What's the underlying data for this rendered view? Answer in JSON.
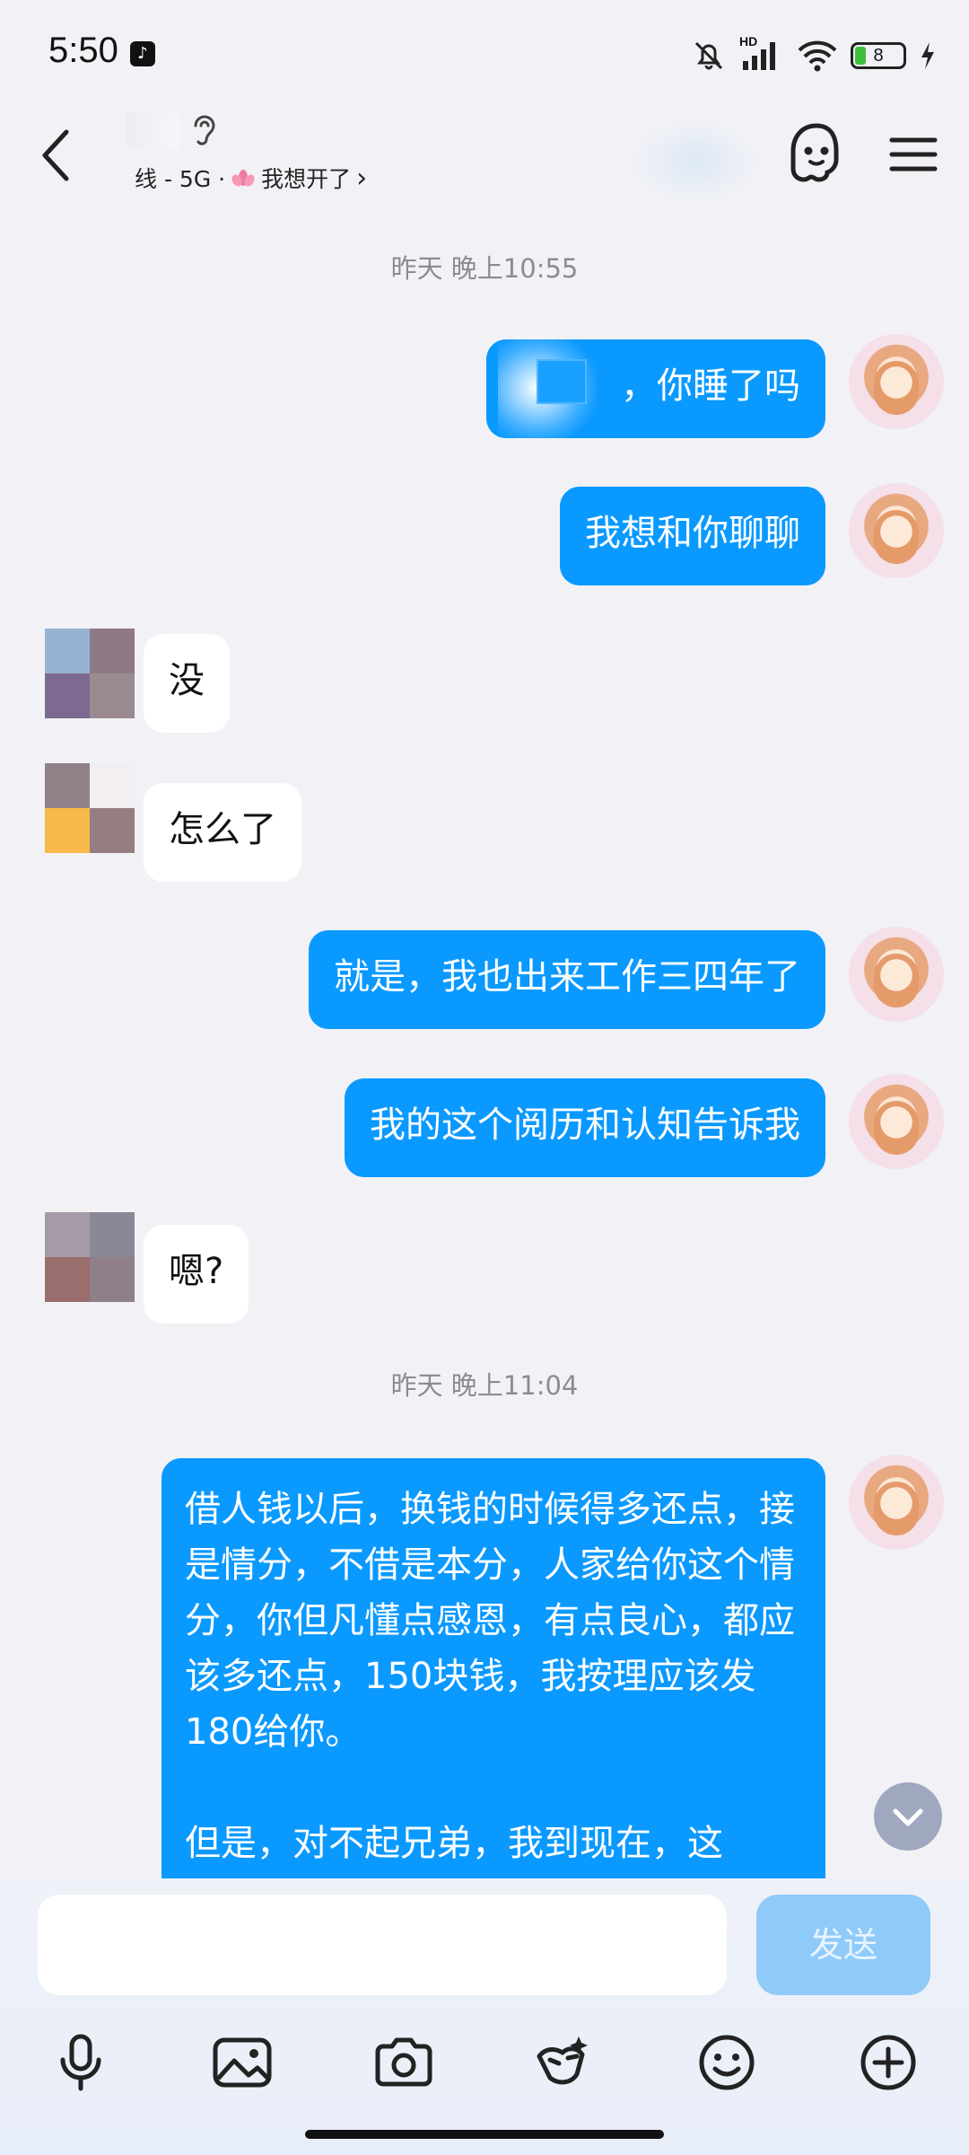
{
  "status_bar": {
    "time": "5:50",
    "hd_label": "HD",
    "battery_level": "8"
  },
  "header": {
    "subtitle_prefix": "线 - 5G ·",
    "subtitle_status": "我想开了",
    "subtitle_chevron": "›"
  },
  "chat": {
    "timestamp_1": "昨天 晚上10:55",
    "msg_1": "，你睡了吗",
    "msg_2": "我想和你聊聊",
    "msg_3": "没",
    "msg_4": "怎么了",
    "msg_5": "就是，我也出来工作三四年了",
    "msg_6": "我的这个阅历和认知告诉我",
    "msg_7": "嗯?",
    "timestamp_2": "昨天 晚上11:04",
    "msg_8_para1": "借人钱以后，换钱的时候得多还点，接是情分，不借是本分，人家给你这个情分，你但凡懂点感恩，有点良心，都应该多还点，150块钱，我按理应该发180给你。",
    "msg_8_para2": "但是，对不起兄弟，我到现在，这"
  },
  "composer": {
    "input_value": "",
    "send_label": "发送"
  },
  "colors": {
    "self_bubble": "#0a99ff",
    "other_bubble": "#ffffff",
    "background": "#f2f2f6",
    "send_disabled": "#8fcaf9"
  },
  "icons": [
    "back-icon",
    "ear-icon",
    "ghost-icon",
    "menu-icon",
    "mic-icon",
    "image-icon",
    "camera-icon",
    "sticker-icon",
    "emoji-icon",
    "plus-icon",
    "chevron-down-icon"
  ]
}
